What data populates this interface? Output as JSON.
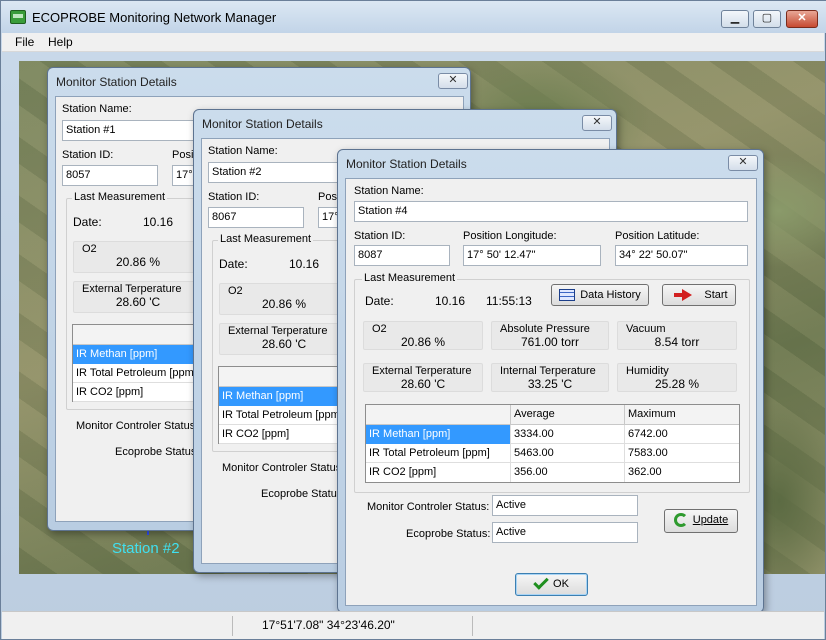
{
  "app": {
    "title": "ECOPROBE Monitoring Network Manager",
    "caption_buttons": {
      "minimize": "▁",
      "maximize": "▢",
      "close": "✕"
    }
  },
  "menu": {
    "file": "File",
    "help": "Help"
  },
  "map": {
    "station2_label": "Station #2"
  },
  "statusbar": {
    "coords": "17°51'7.08\"    34°23'46.20\""
  },
  "dialog_title": "Monitor Station Details",
  "labels": {
    "station_name": "Station Name:",
    "station_id": "Station ID:",
    "position_prefix": "Positi",
    "position_prefix2": "Posi",
    "pos_longitude": "Position Longitude:",
    "pos_latitude": "Position Latitude:",
    "last_measurement": "Last Measurement",
    "date": "Date:",
    "o2": "O2",
    "absolute_pressure": "Absolute Pressure",
    "vacuum": "Vacuum",
    "external_temp": "External Terperature",
    "internal_temp": "Internal Terperature",
    "humidity": "Humidity",
    "monitor_status": "Monitor Controler Status:",
    "ecoprobe_status": "Ecoprobe Status:",
    "col_average": "Average",
    "col_maximum": "Maximum"
  },
  "sensors": [
    "IR Methan [ppm]",
    "IR Total Petroleum [ppm]",
    "IR CO2 [ppm]"
  ],
  "dialog1": {
    "station_name": "Station #1",
    "station_id": "8057",
    "pos_partial": "17°",
    "date": "10.16",
    "o2": "20.86 %",
    "ext_temp": "28.60 'C"
  },
  "dialog2": {
    "station_name": "Station #2",
    "station_id": "8067",
    "pos_partial": "17°",
    "date": "10.16",
    "o2": "20.86 %",
    "ext_temp": "28.60 'C"
  },
  "dialog4": {
    "station_name": "Station #4",
    "station_id": "8087",
    "longitude": "17° 50' 12.47\"",
    "latitude": "34° 22' 50.07\"",
    "date": "10.16",
    "time": "11:55:13",
    "o2": "20.86 %",
    "abs_pressure": "761.00 torr",
    "vacuum": "8.54 torr",
    "ext_temp": "28.60 'C",
    "int_temp": "33.25 'C",
    "humidity": "25.28 %",
    "rows": [
      {
        "sensor": "IR Methan [ppm]",
        "average": "3334.00",
        "maximum": "6742.00"
      },
      {
        "sensor": "IR Total Petroleum [ppm]",
        "average": "5463.00",
        "maximum": "7583.00"
      },
      {
        "sensor": "IR CO2 [ppm]",
        "average": "356.00",
        "maximum": "362.00"
      }
    ],
    "monitor_status": "Active",
    "ecoprobe_status": "Active",
    "buttons": {
      "data_history": "Data History",
      "start": "Start",
      "update": "Update",
      "ok": "OK"
    }
  }
}
